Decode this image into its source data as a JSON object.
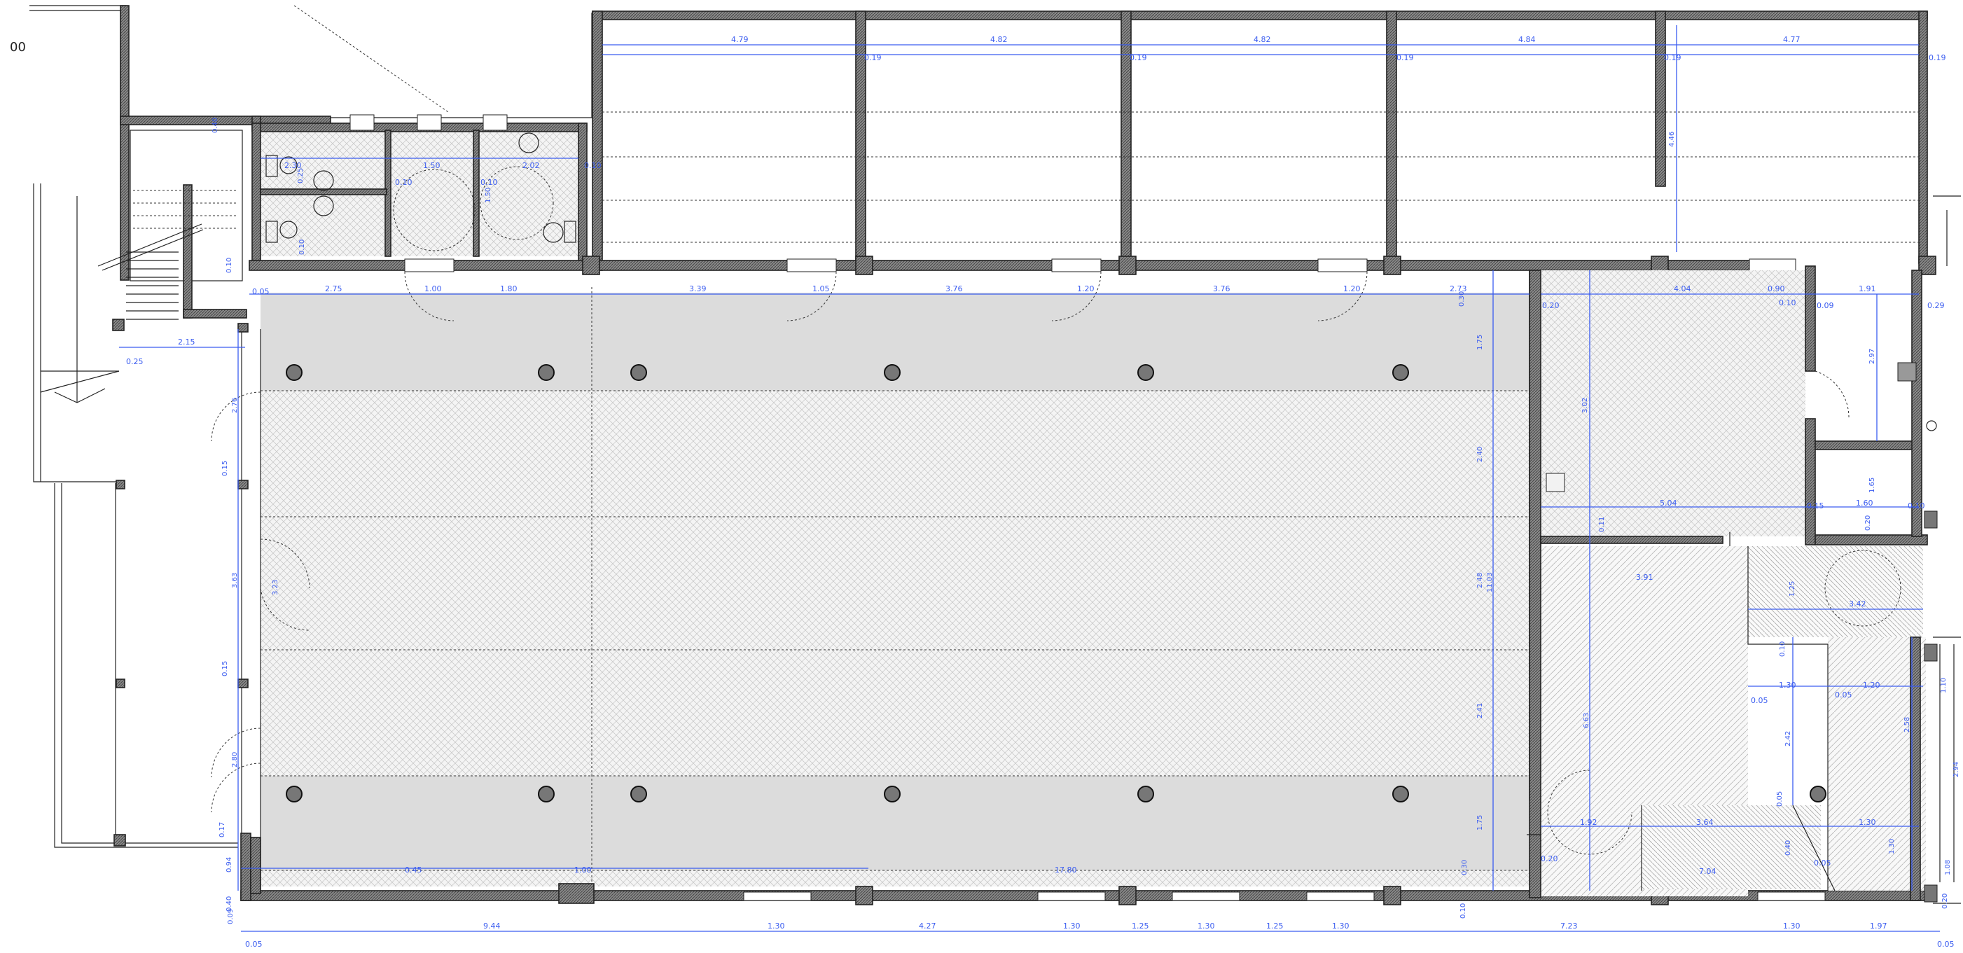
{
  "corner_label": "00",
  "top_bay_dims": [
    "4.79",
    "4.82",
    "4.82",
    "4.84",
    "4.77"
  ],
  "top_wall_dims": [
    "0.19",
    "0.19",
    "0.19",
    "0.19",
    "0.19",
    "0.19"
  ],
  "bay_height_dim": "4.46",
  "bathroom_dims": [
    "2.30",
    "1.50",
    "2.02",
    "0.10",
    "0.25",
    "0.10",
    "1.50",
    "0.10",
    "0.10",
    "0.05"
  ],
  "stair_dims": [
    "0.40",
    "0.10",
    "2.15",
    "0.25"
  ],
  "inner_top_dims": [
    "2.75",
    "1.00",
    "1.80",
    "3.39",
    "1.05",
    "3.76",
    "1.20",
    "3.76",
    "1.20",
    "2.73"
  ],
  "left_vertical_dims": [
    "2.76",
    "0.15",
    "3.63",
    "0.15",
    "2.80",
    "0.17",
    "0.94",
    "0.40",
    "0.09",
    "3.23"
  ],
  "right_column_dims": [
    "0.30",
    "1.75",
    "2.40",
    "2.48",
    "2.41",
    "1.75",
    "0.30",
    "11.03",
    "0.10"
  ],
  "bottom_inner_dims": [
    "0.45",
    "1.00",
    "17.80"
  ],
  "bottom_dims": [
    "0.05",
    "9.44",
    "1.30",
    "4.27",
    "1.30",
    "1.25",
    "1.30",
    "1.25",
    "1.30",
    "7.23",
    "1.30",
    "1.97",
    "0.05"
  ],
  "east_dims": [
    "0.20",
    "4.04",
    "0.90",
    "1.91",
    "0.29",
    "0.10",
    "0.09",
    "2.97",
    "3.02",
    "5.04",
    "1.60",
    "0.15",
    "0.10",
    "1.65",
    "0.11",
    "0.20",
    "3.91",
    "3.42",
    "1.25",
    "1.30",
    "1.20",
    "0.05",
    "0.05",
    "1.10",
    "2.58",
    "0.10",
    "6.63",
    "2.42",
    "1.92",
    "3.64",
    "1.30",
    "0.05",
    "7.04",
    "1.30",
    "0.40",
    "1.08",
    "2.94",
    "0.20",
    "0.05",
    "0.20"
  ],
  "colors": {
    "dimension": "#3a5cf0",
    "wall": "#555555",
    "floor_grey": "#dcdcdc",
    "line": "#222222"
  }
}
